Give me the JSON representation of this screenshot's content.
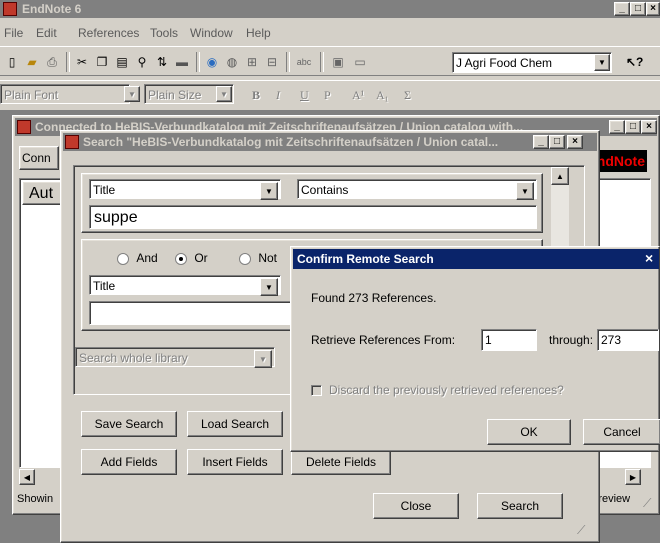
{
  "app": {
    "title": "EndNote 6",
    "menu": [
      "File",
      "Edit",
      "References",
      "Tools",
      "Window",
      "Help"
    ],
    "style_select": "J Agri Food Chem",
    "font_select": "Plain Font",
    "size_select": "Plain Size",
    "format_buttons": [
      "B",
      "I",
      "U",
      "P",
      "A¹",
      "A₁",
      "Σ"
    ]
  },
  "library_window": {
    "title": "Connected to HeBIS-Verbundkatalog mit Zeitschriftenaufsätzen / Union catalog with...",
    "tab_label": "Conn",
    "column_label": "Aut",
    "status": "Showin",
    "logo": "EndNote",
    "preview": "Preview"
  },
  "search_window": {
    "title": "Search \"HeBIS-Verbundkatalog mit Zeitschriftenaufsätzen / Union catal...",
    "field1": "Title",
    "op1": "Contains",
    "value1": "suppe",
    "bool_and": "And",
    "bool_or": "Or",
    "bool_not": "Not",
    "field2": "Title",
    "value2": "",
    "scope": "Search whole library",
    "save_search": "Save Search",
    "load_search": "Load Search",
    "add_fields": "Add Fields",
    "insert_fields": "Insert Fields",
    "delete_fields": "Delete Fields",
    "close": "Close",
    "search": "Search"
  },
  "dialog": {
    "title": "Confirm Remote Search",
    "found": "Found 273 References.",
    "retrieve_label": "Retrieve References From:",
    "from_value": "1",
    "through_label": "through:",
    "through_value": "273",
    "discard_label": "Discard the previously retrieved references?",
    "ok": "OK",
    "cancel": "Cancel"
  }
}
